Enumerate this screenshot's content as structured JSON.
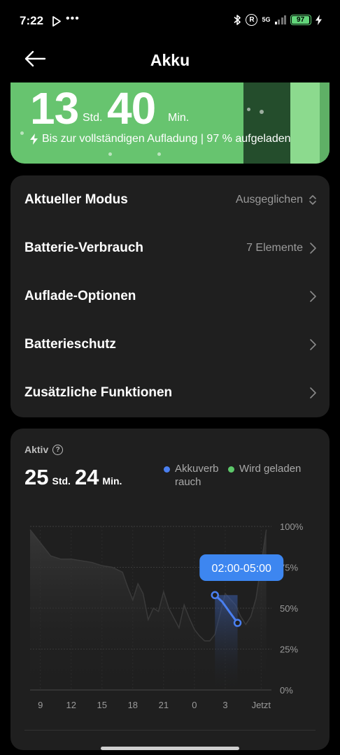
{
  "status_bar": {
    "time": "7:22",
    "network": "5G",
    "battery_level": "97",
    "battery_color": "#62d57a",
    "icons": [
      "play-store-icon",
      "more-dots-icon",
      "bluetooth-icon",
      "registered-icon",
      "signal-icon",
      "battery-icon",
      "charging-bolt-icon"
    ]
  },
  "header": {
    "title": "Akku",
    "back_icon": "back-arrow-icon"
  },
  "hero": {
    "hours": "13",
    "hours_unit": "Std.",
    "minutes": "40",
    "minutes_unit": "Min.",
    "charging_text": "Bis zur vollständigen Aufladung | 97 % aufgeladen",
    "background_color": "#67c46f"
  },
  "settings": {
    "rows": [
      {
        "label": "Aktueller Modus",
        "value": "Ausgeglichen",
        "icon": "up-down-chevron-icon"
      },
      {
        "label": "Batterie-Verbrauch",
        "value": "7 Elemente",
        "icon": "chevron-right-icon"
      },
      {
        "label": "Auflade-Optionen",
        "value": "",
        "icon": "chevron-right-icon"
      },
      {
        "label": "Batterieschutz",
        "value": "",
        "icon": "chevron-right-icon"
      },
      {
        "label": "Zusätzliche Funktionen",
        "value": "",
        "icon": "chevron-right-icon"
      }
    ]
  },
  "usage": {
    "label": "Aktiv",
    "hours": "25",
    "hours_unit": "Std.",
    "minutes": "24",
    "minutes_unit": "Min.",
    "legend": [
      {
        "name": "Akkuverb\nrauch",
        "color": "#4a7ff0"
      },
      {
        "name": "Wird geladen",
        "color": "#5dc86a"
      }
    ],
    "tooltip": "02:00-05:00"
  },
  "chart_data": {
    "type": "area",
    "x_tick_labels": [
      "9",
      "12",
      "15",
      "18",
      "21",
      "0",
      "3",
      "Jetzt"
    ],
    "y_tick_labels": [
      "100%",
      "75%",
      "50%",
      "25%",
      "0%"
    ],
    "ylim": [
      0,
      100
    ],
    "grid": true,
    "series": [
      {
        "name": "history",
        "color": "#3a3a3a",
        "x": [
          8.0,
          9.0,
          10.0,
          11.0,
          12.0,
          13.0,
          14.0,
          15.0,
          16.0,
          17.0,
          17.5,
          18.0,
          18.5,
          19.0,
          19.5,
          20.0,
          20.5,
          21.0,
          21.5,
          22.0,
          22.5,
          23.0,
          23.5,
          24.0,
          24.5,
          25.0,
          25.5,
          26.0,
          27.0,
          28.0,
          28.5,
          29.0,
          29.5,
          30.0,
          31.0
        ],
        "values": [
          98,
          90,
          82,
          80,
          80,
          79,
          78,
          76,
          75,
          72,
          63,
          55,
          65,
          59,
          43,
          50,
          48,
          60,
          50,
          44,
          38,
          52,
          44,
          37,
          33,
          30,
          30,
          34,
          59,
          52,
          45,
          40,
          45,
          56,
          98
        ]
      },
      {
        "name": "Akkuverb rauch",
        "color": "#4a7ff0",
        "x": [
          26.0,
          26.7,
          27.5,
          28.2
        ],
        "values": [
          58,
          54,
          47,
          41
        ]
      }
    ]
  }
}
